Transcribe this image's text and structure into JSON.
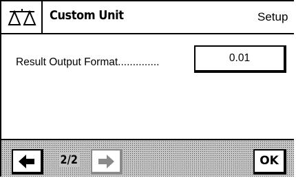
{
  "header": {
    "scale_icon": "balance-scale-icon",
    "title": "Custom Unit",
    "mode": "Setup"
  },
  "main": {
    "row_label": "Result Output Format..............",
    "row_value": "0.01"
  },
  "footer": {
    "back_icon": "arrow-left-icon",
    "page_indicator": "2/2",
    "forward_icon": "arrow-right-icon",
    "forward_enabled": false,
    "ok_label": "OK"
  }
}
